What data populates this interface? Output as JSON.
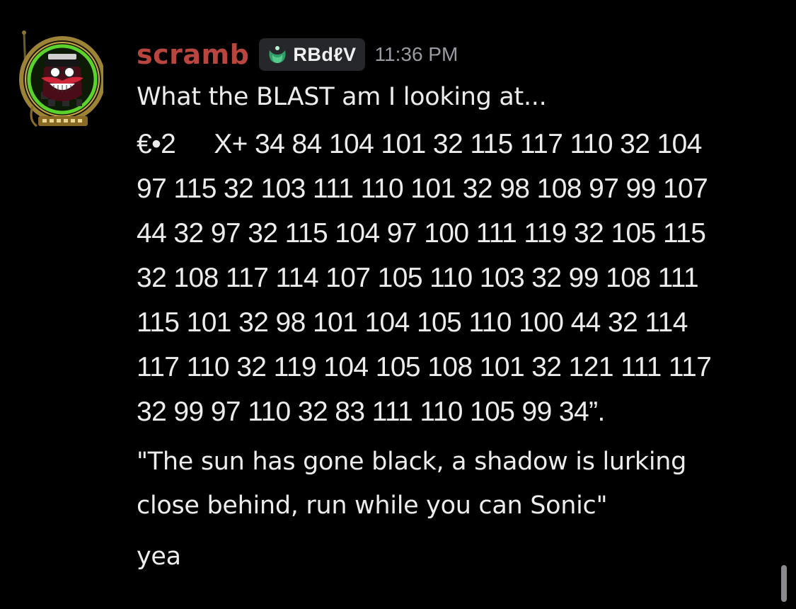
{
  "message": {
    "username": "scramb",
    "tag": {
      "icon": "leaf-badge-icon",
      "label": "RBdℓV"
    },
    "timestamp": "11:36 PM",
    "lines": {
      "first": "What the BLAST am I looking at...",
      "code_lead": "€•2",
      "code_lines": [
        "X+  34 84 104 101 32 115 117 110 32 104",
        "97 115 32 103 111 110 101 32 98 108 97 99 107",
        "44 32 97 32 115 104 97 100 111 119 32 105 115",
        "32 108 117 114 107 105 110 103 32 99 108 111",
        "115 101 32 98 101 104 105 110 100 44 32 114",
        "117 110 32 119 104 105 108 101 32 121 111 117",
        "32 99 97 110 32 83 111 110 105 99 34”."
      ],
      "quote_lines": [
        "\"The sun has gone black, a shadow is lurking",
        "close behind, run while you can Sonic\""
      ],
      "last": "yea"
    }
  },
  "colors": {
    "background": "#000000",
    "username": "#b8463f",
    "tag_background": "#26272b",
    "timestamp": "#9a9aa2",
    "text": "#ececee"
  },
  "avatar": {
    "icon": "eggman-avatar-icon"
  }
}
